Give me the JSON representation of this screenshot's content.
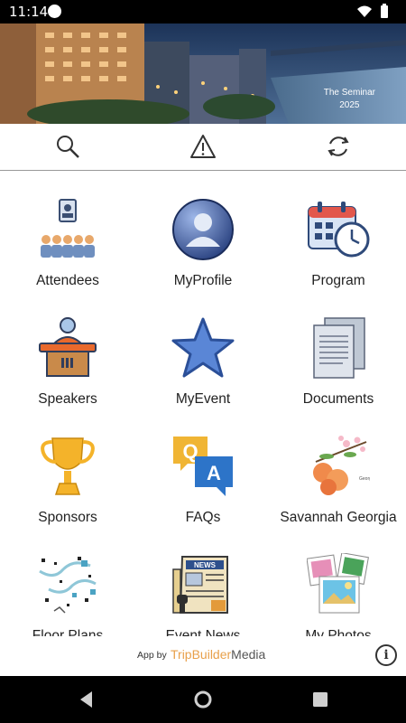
{
  "status_bar": {
    "time": "11:14"
  },
  "banner": {
    "line1": "The Seminar",
    "line2": "2025"
  },
  "toolbar": {
    "icons": [
      "search-icon",
      "warning-icon",
      "refresh-icon"
    ]
  },
  "tiles": [
    {
      "label": "Attendees"
    },
    {
      "label": "MyProfile"
    },
    {
      "label": "Program"
    },
    {
      "label": "Speakers"
    },
    {
      "label": "MyEvent"
    },
    {
      "label": "Documents"
    },
    {
      "label": "Sponsors"
    },
    {
      "label": "FAQs"
    },
    {
      "label": "Savannah  Georgia"
    },
    {
      "label": "Floor Plans"
    },
    {
      "label": "Event News"
    },
    {
      "label": "My Photos"
    }
  ],
  "footer": {
    "app_by": "App by",
    "brand_a": "TripBuilder",
    "brand_b": "Media"
  },
  "nav": {
    "icons": [
      "back-icon",
      "home-icon",
      "recents-icon"
    ]
  }
}
